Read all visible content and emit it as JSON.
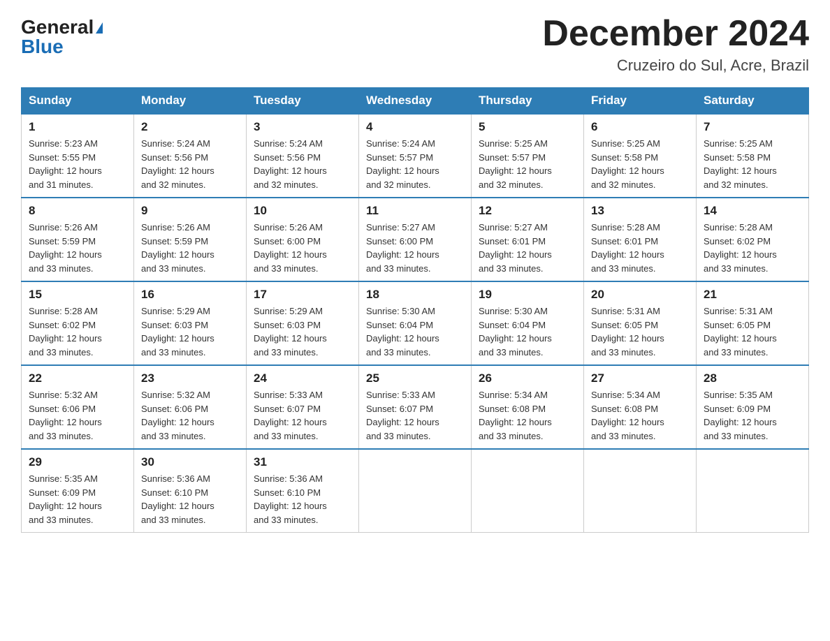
{
  "header": {
    "logo_general": "General",
    "logo_blue": "Blue",
    "month_title": "December 2024",
    "location": "Cruzeiro do Sul, Acre, Brazil"
  },
  "weekdays": [
    "Sunday",
    "Monday",
    "Tuesday",
    "Wednesday",
    "Thursday",
    "Friday",
    "Saturday"
  ],
  "weeks": [
    [
      {
        "day": "1",
        "sunrise": "5:23 AM",
        "sunset": "5:55 PM",
        "daylight": "12 hours and 31 minutes."
      },
      {
        "day": "2",
        "sunrise": "5:24 AM",
        "sunset": "5:56 PM",
        "daylight": "12 hours and 32 minutes."
      },
      {
        "day": "3",
        "sunrise": "5:24 AM",
        "sunset": "5:56 PM",
        "daylight": "12 hours and 32 minutes."
      },
      {
        "day": "4",
        "sunrise": "5:24 AM",
        "sunset": "5:57 PM",
        "daylight": "12 hours and 32 minutes."
      },
      {
        "day": "5",
        "sunrise": "5:25 AM",
        "sunset": "5:57 PM",
        "daylight": "12 hours and 32 minutes."
      },
      {
        "day": "6",
        "sunrise": "5:25 AM",
        "sunset": "5:58 PM",
        "daylight": "12 hours and 32 minutes."
      },
      {
        "day": "7",
        "sunrise": "5:25 AM",
        "sunset": "5:58 PM",
        "daylight": "12 hours and 32 minutes."
      }
    ],
    [
      {
        "day": "8",
        "sunrise": "5:26 AM",
        "sunset": "5:59 PM",
        "daylight": "12 hours and 33 minutes."
      },
      {
        "day": "9",
        "sunrise": "5:26 AM",
        "sunset": "5:59 PM",
        "daylight": "12 hours and 33 minutes."
      },
      {
        "day": "10",
        "sunrise": "5:26 AM",
        "sunset": "6:00 PM",
        "daylight": "12 hours and 33 minutes."
      },
      {
        "day": "11",
        "sunrise": "5:27 AM",
        "sunset": "6:00 PM",
        "daylight": "12 hours and 33 minutes."
      },
      {
        "day": "12",
        "sunrise": "5:27 AM",
        "sunset": "6:01 PM",
        "daylight": "12 hours and 33 minutes."
      },
      {
        "day": "13",
        "sunrise": "5:28 AM",
        "sunset": "6:01 PM",
        "daylight": "12 hours and 33 minutes."
      },
      {
        "day": "14",
        "sunrise": "5:28 AM",
        "sunset": "6:02 PM",
        "daylight": "12 hours and 33 minutes."
      }
    ],
    [
      {
        "day": "15",
        "sunrise": "5:28 AM",
        "sunset": "6:02 PM",
        "daylight": "12 hours and 33 minutes."
      },
      {
        "day": "16",
        "sunrise": "5:29 AM",
        "sunset": "6:03 PM",
        "daylight": "12 hours and 33 minutes."
      },
      {
        "day": "17",
        "sunrise": "5:29 AM",
        "sunset": "6:03 PM",
        "daylight": "12 hours and 33 minutes."
      },
      {
        "day": "18",
        "sunrise": "5:30 AM",
        "sunset": "6:04 PM",
        "daylight": "12 hours and 33 minutes."
      },
      {
        "day": "19",
        "sunrise": "5:30 AM",
        "sunset": "6:04 PM",
        "daylight": "12 hours and 33 minutes."
      },
      {
        "day": "20",
        "sunrise": "5:31 AM",
        "sunset": "6:05 PM",
        "daylight": "12 hours and 33 minutes."
      },
      {
        "day": "21",
        "sunrise": "5:31 AM",
        "sunset": "6:05 PM",
        "daylight": "12 hours and 33 minutes."
      }
    ],
    [
      {
        "day": "22",
        "sunrise": "5:32 AM",
        "sunset": "6:06 PM",
        "daylight": "12 hours and 33 minutes."
      },
      {
        "day": "23",
        "sunrise": "5:32 AM",
        "sunset": "6:06 PM",
        "daylight": "12 hours and 33 minutes."
      },
      {
        "day": "24",
        "sunrise": "5:33 AM",
        "sunset": "6:07 PM",
        "daylight": "12 hours and 33 minutes."
      },
      {
        "day": "25",
        "sunrise": "5:33 AM",
        "sunset": "6:07 PM",
        "daylight": "12 hours and 33 minutes."
      },
      {
        "day": "26",
        "sunrise": "5:34 AM",
        "sunset": "6:08 PM",
        "daylight": "12 hours and 33 minutes."
      },
      {
        "day": "27",
        "sunrise": "5:34 AM",
        "sunset": "6:08 PM",
        "daylight": "12 hours and 33 minutes."
      },
      {
        "day": "28",
        "sunrise": "5:35 AM",
        "sunset": "6:09 PM",
        "daylight": "12 hours and 33 minutes."
      }
    ],
    [
      {
        "day": "29",
        "sunrise": "5:35 AM",
        "sunset": "6:09 PM",
        "daylight": "12 hours and 33 minutes."
      },
      {
        "day": "30",
        "sunrise": "5:36 AM",
        "sunset": "6:10 PM",
        "daylight": "12 hours and 33 minutes."
      },
      {
        "day": "31",
        "sunrise": "5:36 AM",
        "sunset": "6:10 PM",
        "daylight": "12 hours and 33 minutes."
      },
      null,
      null,
      null,
      null
    ]
  ],
  "labels": {
    "sunrise_prefix": "Sunrise: ",
    "sunset_prefix": "Sunset: ",
    "daylight_prefix": "Daylight: "
  }
}
